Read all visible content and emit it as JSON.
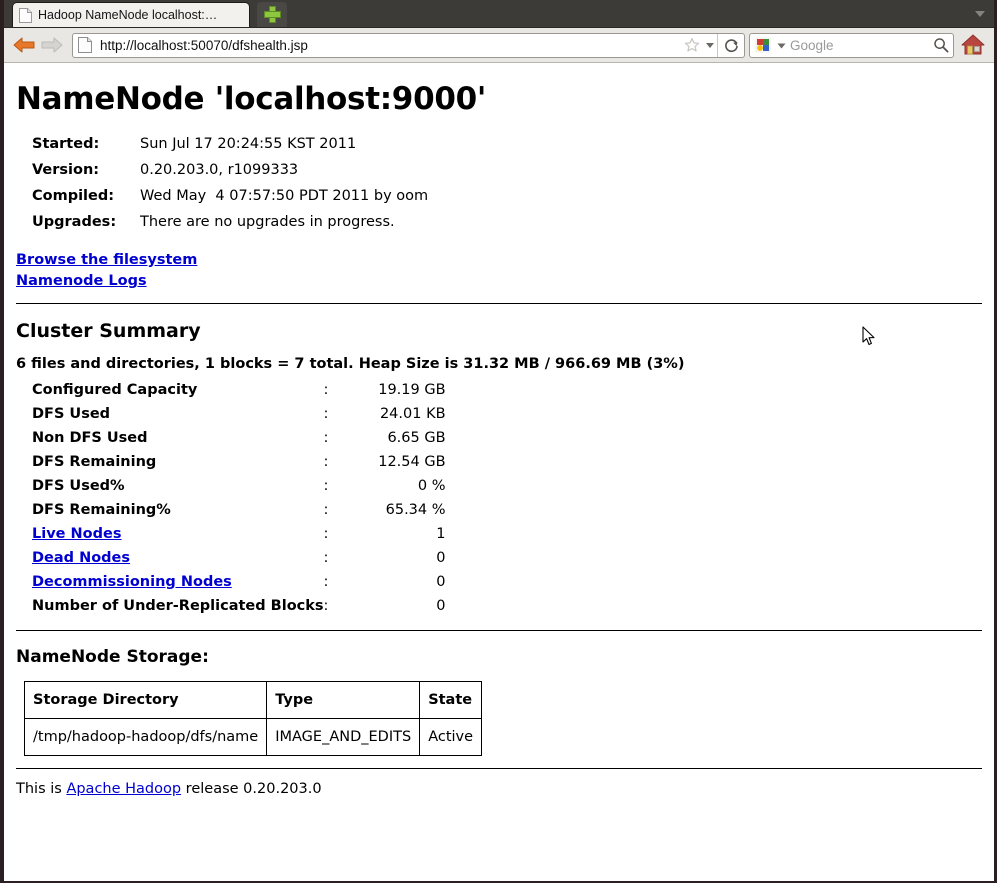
{
  "browser": {
    "tab": {
      "title": "Hadoop NameNode localhost:…",
      "favicon_name": "page-icon"
    },
    "new_tab_label": "+",
    "back_label": "Back",
    "forward_label": "Forward",
    "url": "http://localhost:50070/dfshealth.jsp",
    "url_favicon_name": "page-icon",
    "bookmark_icon_name": "star-icon",
    "reload_icon_name": "reload-icon",
    "home_icon_name": "home-icon",
    "search": {
      "engine": "Google",
      "placeholder": "Google",
      "engine_icon_name": "google-icon",
      "go_icon_name": "magnifier-icon"
    },
    "tab_list_icon_name": "chevron-down-icon"
  },
  "page": {
    "title": "NameNode 'localhost:9000'",
    "info": [
      {
        "label": "Started:",
        "value": "Sun Jul 17 20:24:55 KST 2011"
      },
      {
        "label": "Version:",
        "value": "0.20.203.0, r1099333"
      },
      {
        "label": "Compiled:",
        "value": "Wed May  4 07:57:50 PDT 2011 by oom"
      },
      {
        "label": "Upgrades:",
        "value": "There are no upgrades in progress."
      }
    ],
    "links": [
      {
        "label": "Browse the filesystem"
      },
      {
        "label": "Namenode Logs"
      }
    ],
    "cluster_summary": {
      "heading": "Cluster Summary",
      "summary_line": "6 files and directories, 1 blocks = 7 total. Heap Size is 31.32 MB / 966.69 MB (3%)",
      "colon": ":",
      "rows": [
        {
          "name": "Configured Capacity",
          "value": "19.19 GB",
          "is_link": false
        },
        {
          "name": "DFS Used",
          "value": "24.01 KB",
          "is_link": false
        },
        {
          "name": "Non DFS Used",
          "value": "6.65 GB",
          "is_link": false
        },
        {
          "name": "DFS Remaining",
          "value": "12.54 GB",
          "is_link": false
        },
        {
          "name": "DFS Used%",
          "value": "0 %",
          "is_link": false
        },
        {
          "name": "DFS Remaining%",
          "value": "65.34 %",
          "is_link": false
        },
        {
          "name": "Live Nodes",
          "value": "1",
          "is_link": true
        },
        {
          "name": "Dead Nodes",
          "value": "0",
          "is_link": true
        },
        {
          "name": "Decommissioning Nodes",
          "value": "0",
          "is_link": true
        },
        {
          "name": "Number of Under-Replicated Blocks",
          "value": "0",
          "is_link": false
        }
      ]
    },
    "storage": {
      "heading": "NameNode Storage:",
      "columns": [
        "Storage Directory",
        "Type",
        "State"
      ],
      "rows": [
        [
          "/tmp/hadoop-hadoop/dfs/name",
          "IMAGE_AND_EDITS",
          "Active"
        ]
      ]
    },
    "footer": {
      "prefix": "This is ",
      "link": "Apache Hadoop",
      "suffix": " release 0.20.203.0"
    }
  },
  "colors": {
    "link": "#0000d0",
    "chrome_bg": "#e9e7e4",
    "tabstrip_bg": "#3d3b38",
    "window_border": "#2b1f22",
    "accent_green": "#8dc63f"
  }
}
